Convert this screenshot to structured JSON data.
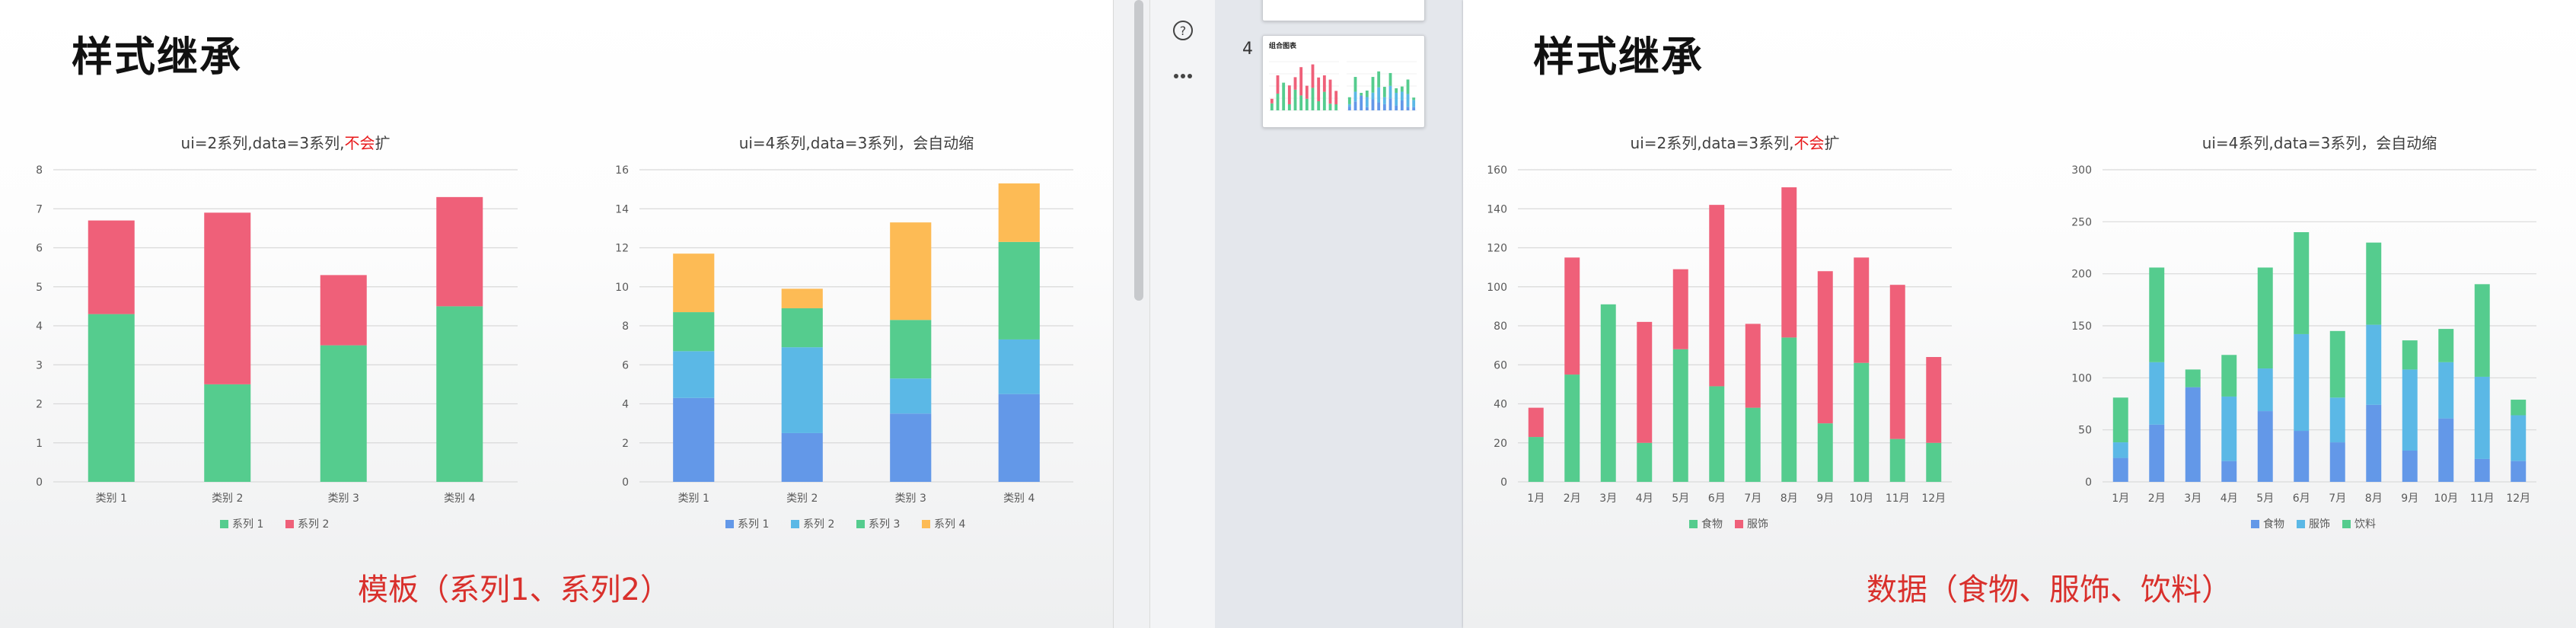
{
  "slides": {
    "left": {
      "heading": "样式继承",
      "caption": "模板（系列1、系列2）",
      "chart1": {
        "title": {
          "prefix": "ui=2系列,data=3系列,",
          "red": "不会",
          "suffix": "扩"
        },
        "categories": [
          "类别 1",
          "类别 2",
          "类别 3",
          "类别 4"
        ],
        "y_ticks": [
          "0",
          "1",
          "2",
          "3",
          "4",
          "5",
          "6",
          "7",
          "8"
        ],
        "ylim": [
          0,
          8
        ],
        "series": [
          {
            "name": "系列 1",
            "color": "#55cc8e",
            "values": [
              4.3,
              2.5,
              3.5,
              4.5
            ]
          },
          {
            "name": "系列 2",
            "color": "#ef6079",
            "values": [
              2.4,
              4.4,
              1.8,
              2.8
            ]
          }
        ]
      },
      "chart2": {
        "title": {
          "prefix": "ui=4系列,data=3系列，会自动缩",
          "red": "",
          "suffix": ""
        },
        "categories": [
          "类别 1",
          "类别 2",
          "类别 3",
          "类别 4"
        ],
        "y_ticks": [
          "0",
          "2",
          "4",
          "6",
          "8",
          "10",
          "12",
          "14",
          "16"
        ],
        "ylim": [
          0,
          16
        ],
        "series": [
          {
            "name": "系列 1",
            "color": "#6398e8",
            "values": [
              4.3,
              2.5,
              3.5,
              4.5
            ]
          },
          {
            "name": "系列 2",
            "color": "#5bb8e6",
            "values": [
              2.4,
              4.4,
              1.8,
              2.8
            ]
          },
          {
            "name": "系列 3",
            "color": "#55cc8e",
            "values": [
              2.0,
              2.0,
              3.0,
              5.0
            ]
          },
          {
            "name": "系列 4",
            "color": "#fdbb55",
            "values": [
              3.0,
              1.0,
              5.0,
              3.0
            ]
          }
        ]
      }
    },
    "right": {
      "heading": "样式继承",
      "caption": "数据（食物、服饰、饮料）",
      "chart1": {
        "title": {
          "prefix": "ui=2系列,data=3系列,",
          "red": "不会",
          "suffix": "扩"
        },
        "categories": [
          "1月",
          "2月",
          "3月",
          "4月",
          "5月",
          "6月",
          "7月",
          "8月",
          "9月",
          "10月",
          "11月",
          "12月"
        ],
        "y_ticks": [
          "0",
          "20",
          "40",
          "60",
          "80",
          "100",
          "120",
          "140",
          "160"
        ],
        "ylim": [
          0,
          160
        ],
        "series": [
          {
            "name": "食物",
            "color": "#55cc8e",
            "values": [
              23,
              55,
              91,
              20,
              68,
              49,
              38,
              74,
              30,
              61,
              22,
              20
            ]
          },
          {
            "name": "服饰",
            "color": "#ef6079",
            "values": [
              15,
              60,
              0,
              62,
              41,
              93,
              43,
              77,
              78,
              54,
              79,
              44
            ]
          }
        ]
      },
      "chart2": {
        "title": {
          "prefix": "ui=4系列,data=3系列，会自动缩",
          "red": "",
          "suffix": ""
        },
        "categories": [
          "1月",
          "2月",
          "3月",
          "4月",
          "5月",
          "6月",
          "7月",
          "8月",
          "9月",
          "10月",
          "11月",
          "12月"
        ],
        "y_ticks": [
          "0",
          "50",
          "100",
          "150",
          "200",
          "250",
          "300"
        ],
        "ylim": [
          0,
          300
        ],
        "series": [
          {
            "name": "食物",
            "color": "#6398e8",
            "values": [
              23,
              55,
              91,
              20,
              68,
              49,
              38,
              74,
              30,
              61,
              22,
              20
            ]
          },
          {
            "name": "服饰",
            "color": "#5bb8e6",
            "values": [
              15,
              60,
              0,
              62,
              41,
              93,
              43,
              77,
              78,
              54,
              79,
              44
            ]
          },
          {
            "name": "饮料",
            "color": "#55cc8e",
            "values": [
              43,
              91,
              17,
              40,
              97,
              98,
              64,
              79,
              28,
              32,
              89,
              15
            ]
          }
        ]
      }
    }
  },
  "panel": {
    "slide_number": "4",
    "thumbnail_title": "组合图表"
  },
  "colors": {
    "accent_red": "#d9302c",
    "gridline": "#d9d9d9",
    "axis_text": "#595959"
  },
  "icons": [
    "help-circle-icon",
    "more-dots-icon"
  ]
}
